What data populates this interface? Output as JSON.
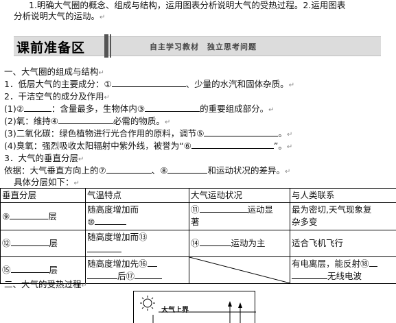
{
  "objectives": {
    "line1": "1.明确大气圈的概念、组成与结构，运用图表分析说明大气的受热过程。2.运用图表",
    "line2": "分析说明大气的运动。"
  },
  "banner": {
    "title": "课前准备区",
    "subtitle": "自主学习教材　独立思考问题"
  },
  "section1": {
    "heading": "一、大气圈的组成与结构",
    "q1_a": "1．低层大气的主要成分：①",
    "q1_b": "、少量的水汽和固体杂质。",
    "q2": "2．干洁空气的成分及作用",
    "q2_1a": "(1)②",
    "q2_1b": "：含量最多，生物体内③",
    "q2_1c": "的重要组成部分。",
    "q2_2a": "(2)氧：维持④",
    "q2_2b": "必需的物质。",
    "q2_3a": "(3)二氧化碳：绿色植物进行光合作用的原料，调节⑤",
    "q2_3b": "。",
    "q2_4a": "(4)臭氧：强烈吸收太阳辐射中紫外线，被誉为“⑥",
    "q2_4b": "”。",
    "q3": "3．大气的垂直分层",
    "q3_basis_a": "依据：大气垂直方向上的⑦",
    "q3_basis_b": "、⑧",
    "q3_basis_c": "和运动状况的差异。",
    "q3_detail": "具体分层如下："
  },
  "table": {
    "headers": [
      "垂直分层",
      "气温特点",
      "大气运动状况",
      "与人类联系"
    ],
    "row1": {
      "layer_a": "⑨",
      "layer_b": "层",
      "temp_a": "随高度增加而",
      "temp_b": "⑩",
      "motion_a": "⑪",
      "motion_b": "运动显",
      "motion_c": "著",
      "human_a": "最为密切,天气现象复",
      "human_b": "杂多变"
    },
    "row2": {
      "layer_a": "⑫",
      "layer_b": "层",
      "temp_a": "随高度增加而⑬",
      "motion_a": "⑭",
      "motion_b": "运动为主",
      "human_a": "适合飞机飞行"
    },
    "row3": {
      "layer_a": "⑮",
      "layer_b": "层",
      "temp_a": "随高度增加先⑯",
      "temp_b": "后⑰",
      "human_a": "有电离层，能反射⑱",
      "human_b": "无线电波"
    }
  },
  "section2": {
    "heading": "二、大气的受热过程",
    "diagram_label": "大气上界"
  },
  "paragraph_mark": "↵"
}
